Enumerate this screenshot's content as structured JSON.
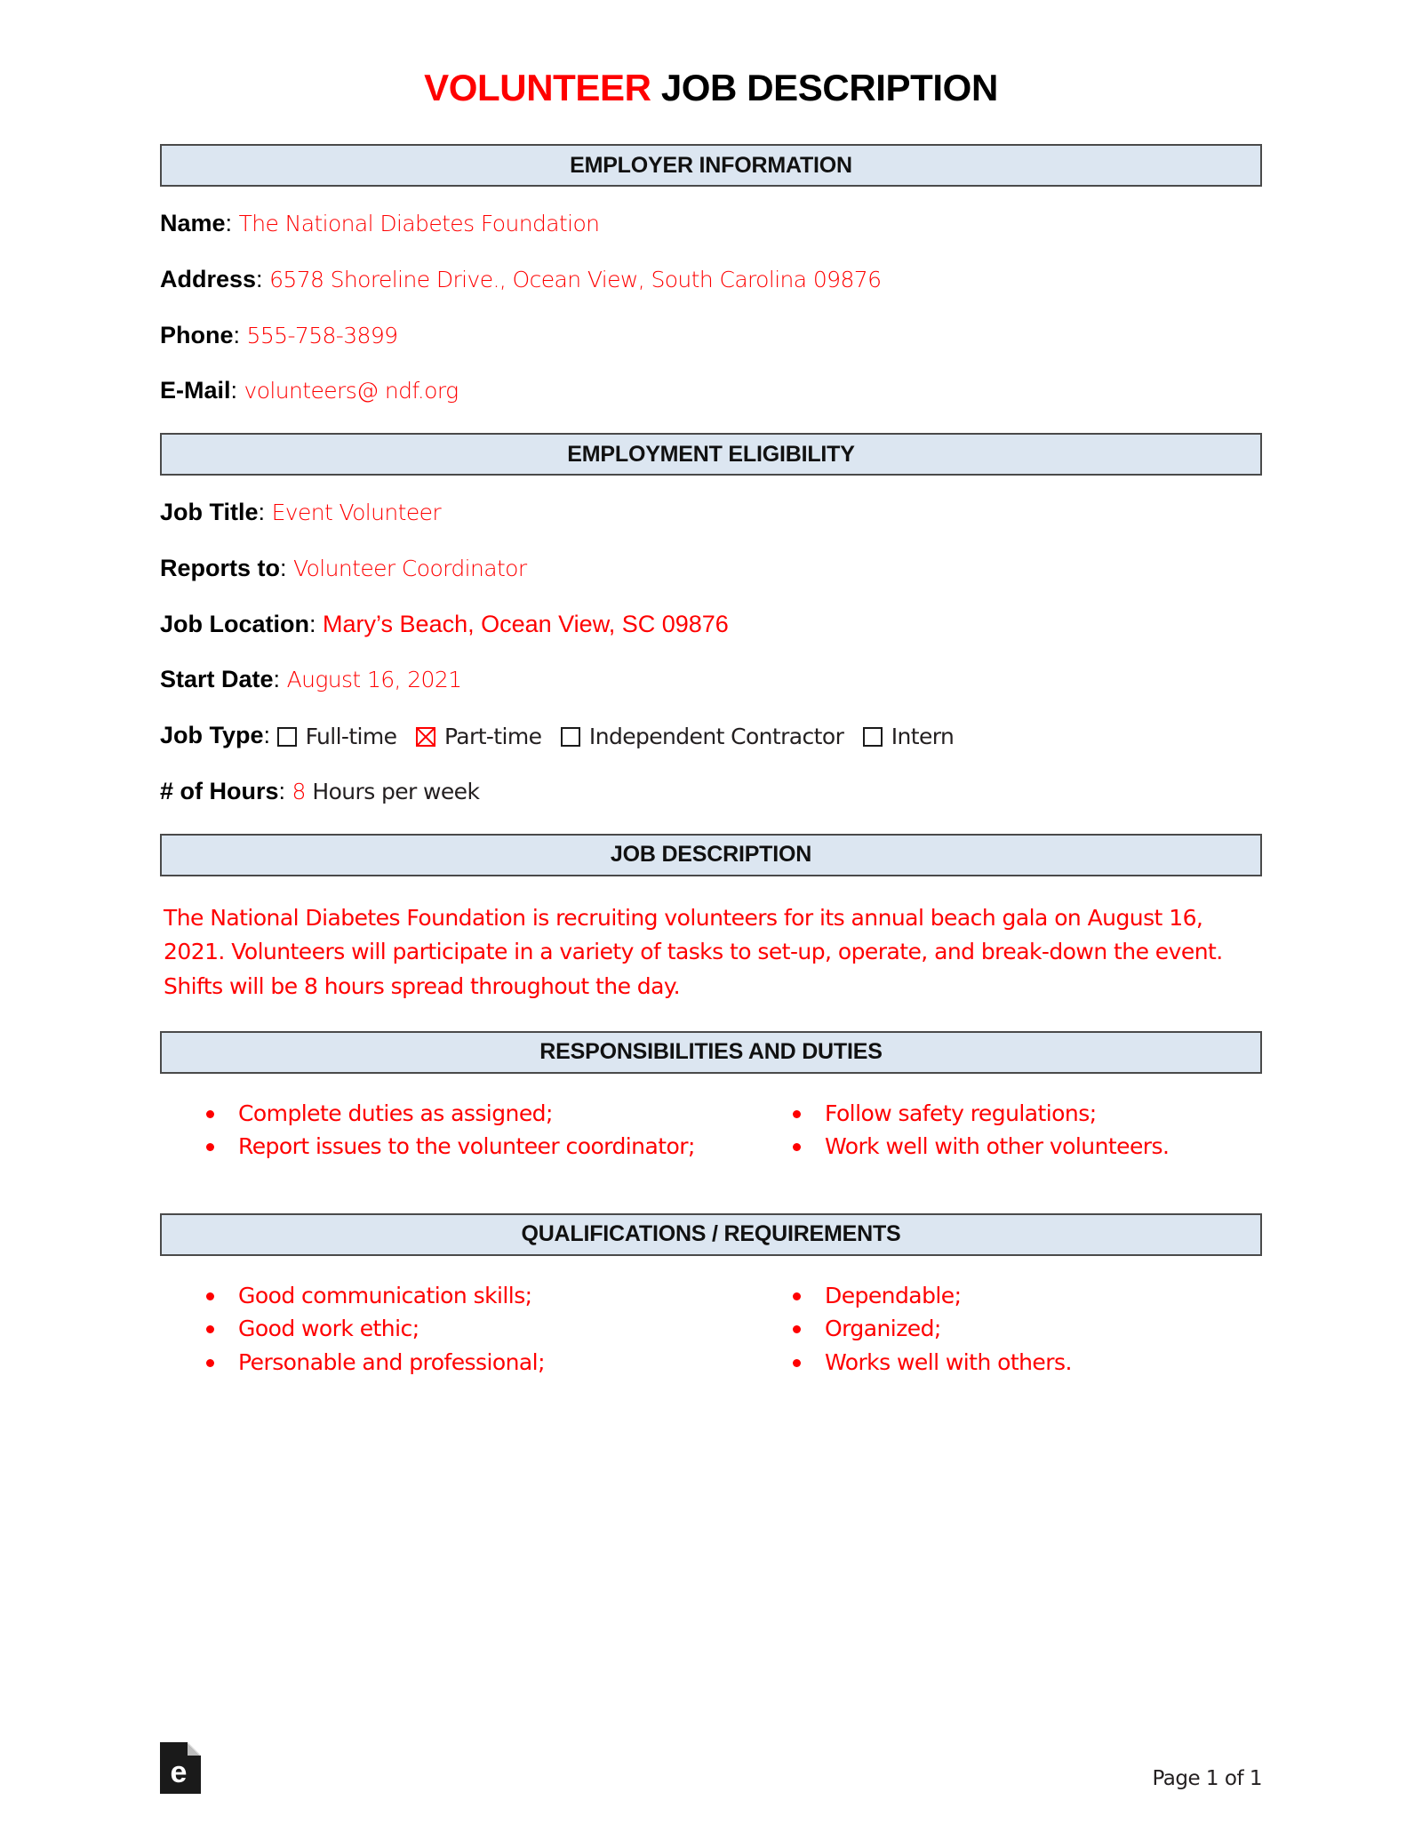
{
  "document": {
    "title_highlight": "VOLUNTEER",
    "title_rest": " JOB DESCRIPTION",
    "accent_color": "#fe0000",
    "section_bar_color": "#dce6f1"
  },
  "employer_section": {
    "heading": "EMPLOYER INFORMATION",
    "fields": [
      {
        "label": "Name",
        "separator": ":",
        "value": "The National Diabetes Foundation"
      },
      {
        "label": "Address",
        "separator": ":",
        "value": "6578 Shoreline Drive., Ocean View, South Carolina 09876"
      },
      {
        "label": "Phone",
        "separator": ":",
        "value": "555-758-3899"
      },
      {
        "label": "E-Mail",
        "separator": ":",
        "value": "volunteers@ ndf.org"
      }
    ]
  },
  "eligibility_section": {
    "heading": "EMPLOYMENT ELIGIBILITY",
    "fields": [
      {
        "label": "Job Title",
        "separator": ":",
        "value": "Event Volunteer"
      },
      {
        "label": "Reports to",
        "separator": ":",
        "value": "Volunteer Coordinator"
      },
      {
        "label": "Job Location",
        "separator": ":",
        "value": "Mary’s Beach, Ocean View, SC 09876"
      },
      {
        "label": "Start Date",
        "separator": ":",
        "value": "August 16, 2021"
      }
    ],
    "job_type": {
      "label": "Job Type",
      "separator": ":",
      "options": [
        {
          "label": "Full-time",
          "checked": false
        },
        {
          "label": "Part-time",
          "checked": true
        },
        {
          "label": "Independent Contractor",
          "checked": false
        },
        {
          "label": "Intern",
          "checked": false
        }
      ]
    },
    "hours": {
      "label": "# of Hours",
      "separator": ":",
      "value": "8",
      "unit": "Hours per week"
    }
  },
  "description_section": {
    "heading": "JOB DESCRIPTION",
    "body": "The National Diabetes Foundation is recruiting volunteers for its annual beach gala on August 16, 2021. Volunteers will participate in a variety of tasks to set-up, operate, and break-down the event. Shifts will be 8 hours spread throughout the day."
  },
  "responsibilities_section": {
    "heading": "RESPONSIBILITIES AND DUTIES",
    "left_items": [
      "Complete duties as assigned;",
      "Report issues to the volunteer coordinator;"
    ],
    "right_items": [
      "Follow safety regulations;",
      "Work well with other volunteers."
    ]
  },
  "qualifications_section": {
    "heading": "QUALIFICATIONS / REQUIREMENTS",
    "left_items": [
      "Good communication skills;",
      "Good work ethic;",
      "Personable and professional;"
    ],
    "right_items": [
      "Dependable;",
      "Organized;",
      "Works well with others."
    ]
  },
  "footer": {
    "logo_letter": "e",
    "page_indicator": "Page 1 of 1"
  }
}
